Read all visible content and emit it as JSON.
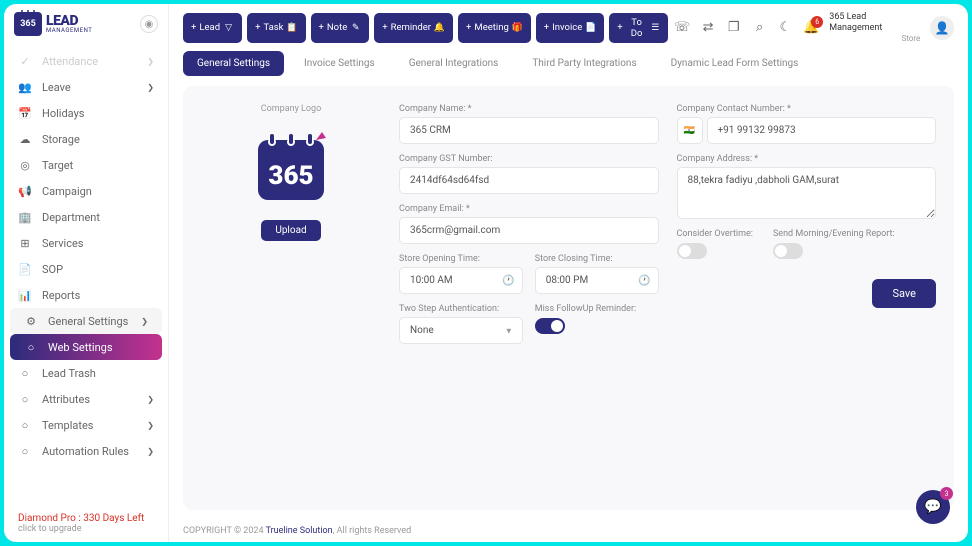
{
  "brand": {
    "main": "LEAD",
    "sub": "MANAGEMENT"
  },
  "sidebar": {
    "items": [
      {
        "icon": "✓",
        "label": "Attendance",
        "muted": true,
        "chevron": true
      },
      {
        "icon": "👥",
        "label": "Leave",
        "chevron": true
      },
      {
        "icon": "📅",
        "label": "Holidays"
      },
      {
        "icon": "☁",
        "label": "Storage"
      },
      {
        "icon": "◎",
        "label": "Target"
      },
      {
        "icon": "📢",
        "label": "Campaign"
      },
      {
        "icon": "🏢",
        "label": "Department"
      },
      {
        "icon": "⊞",
        "label": "Services"
      },
      {
        "icon": "📄",
        "label": "SOP"
      },
      {
        "icon": "📊",
        "label": "Reports"
      },
      {
        "icon": "⚙",
        "label": "General Settings",
        "chevron": true,
        "expanded": true
      },
      {
        "icon": "○",
        "label": "Web Settings",
        "active": true,
        "sub": true
      },
      {
        "icon": "○",
        "label": "Lead Trash",
        "sub": true
      },
      {
        "icon": "○",
        "label": "Attributes",
        "chevron": true,
        "sub": true
      },
      {
        "icon": "○",
        "label": "Templates",
        "chevron": true,
        "sub": true
      },
      {
        "icon": "○",
        "label": "Automation Rules",
        "chevron": true,
        "sub": true
      }
    ]
  },
  "plan": {
    "days": "Diamond Pro : 330 Days Left",
    "upgrade": "click to upgrade"
  },
  "topbar": {
    "pills": [
      {
        "label": "Lead",
        "icon": "▽"
      },
      {
        "label": "Task",
        "icon": "📋"
      },
      {
        "label": "Note",
        "icon": "✎"
      },
      {
        "label": "Reminder",
        "icon": "🔔"
      },
      {
        "label": "Meeting",
        "icon": "🎁"
      },
      {
        "label": "Invoice",
        "icon": "📄"
      },
      {
        "label": "To Do",
        "icon": "☰"
      }
    ],
    "bell_count": "6",
    "user_name": "365 Lead Management",
    "user_role": "Store"
  },
  "tabs": [
    {
      "label": "General Settings",
      "active": true
    },
    {
      "label": "Invoice Settings"
    },
    {
      "label": "General Integrations"
    },
    {
      "label": "Third Party Integrations"
    },
    {
      "label": "Dynamic Lead Form Settings"
    }
  ],
  "form": {
    "logo_label": "Company Logo",
    "upload": "Upload",
    "company_name_label": "Company Name: *",
    "company_name": "365 CRM",
    "gst_label": "Company GST Number:",
    "gst": "2414df64sd64fsd",
    "email_label": "Company Email: *",
    "email": "365crm@gmail.com",
    "contact_label": "Company Contact Number: *",
    "contact": "+91 99132 99873",
    "address_label": "Company Address: *",
    "address": "88,tekra fadiyu ,dabholi GAM,surat",
    "open_label": "Store Opening Time:",
    "open": "10:00 AM",
    "close_label": "Store Closing Time:",
    "close": "08:00 PM",
    "twostep_label": "Two Step Authentication:",
    "twostep": "None",
    "overtime_label": "Consider Overtime:",
    "report_label": "Send Morning/Evening Report:",
    "miss_label": "Miss FollowUp Reminder:",
    "save": "Save"
  },
  "footer": {
    "copyright": "COPYRIGHT © 2024 ",
    "link": "Trueline Solution",
    "rest": ", All rights Reserved"
  },
  "fab_count": "3"
}
